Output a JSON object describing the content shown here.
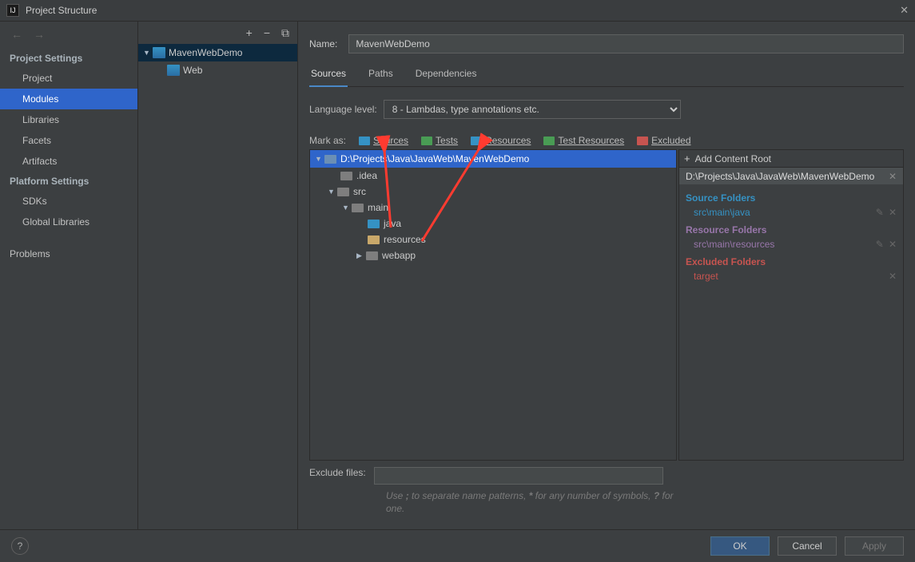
{
  "window": {
    "title": "Project Structure"
  },
  "nav": {
    "section1": "Project Settings",
    "items1": [
      "Project",
      "Modules",
      "Libraries",
      "Facets",
      "Artifacts"
    ],
    "section2": "Platform Settings",
    "items2": [
      "SDKs",
      "Global Libraries"
    ],
    "problems": "Problems"
  },
  "moduleTree": {
    "root": "MavenWebDemo",
    "child": "Web"
  },
  "name": {
    "label": "Name:",
    "value": "MavenWebDemo"
  },
  "tabs": [
    "Sources",
    "Paths",
    "Dependencies"
  ],
  "language": {
    "label": "Language level:",
    "value": "8 - Lambdas, type annotations etc."
  },
  "mark": {
    "label": "Mark as:",
    "sources": "Sources",
    "tests": "Tests",
    "resources": "Resources",
    "testResources": "Test Resources",
    "excluded": "Excluded"
  },
  "srcTree": {
    "root": "D:\\Projects\\Java\\JavaWeb\\MavenWebDemo",
    "idea": ".idea",
    "src": "src",
    "main": "main",
    "java": "java",
    "resources": "resources",
    "webapp": "webapp"
  },
  "rightInfo": {
    "addRoot": "Add Content Root",
    "path": "D:\\Projects\\Java\\JavaWeb\\MavenWebDemo",
    "sourceFolders": {
      "title": "Source Folders",
      "item": "src\\main\\java"
    },
    "resourceFolders": {
      "title": "Resource Folders",
      "item": "src\\main\\resources"
    },
    "excludedFolders": {
      "title": "Excluded Folders",
      "item": "target"
    }
  },
  "exclude": {
    "label": "Exclude files:",
    "hint": "Use ; to separate name patterns, * for any number of symbols, ? for one."
  },
  "buttons": {
    "ok": "OK",
    "cancel": "Cancel",
    "apply": "Apply"
  }
}
